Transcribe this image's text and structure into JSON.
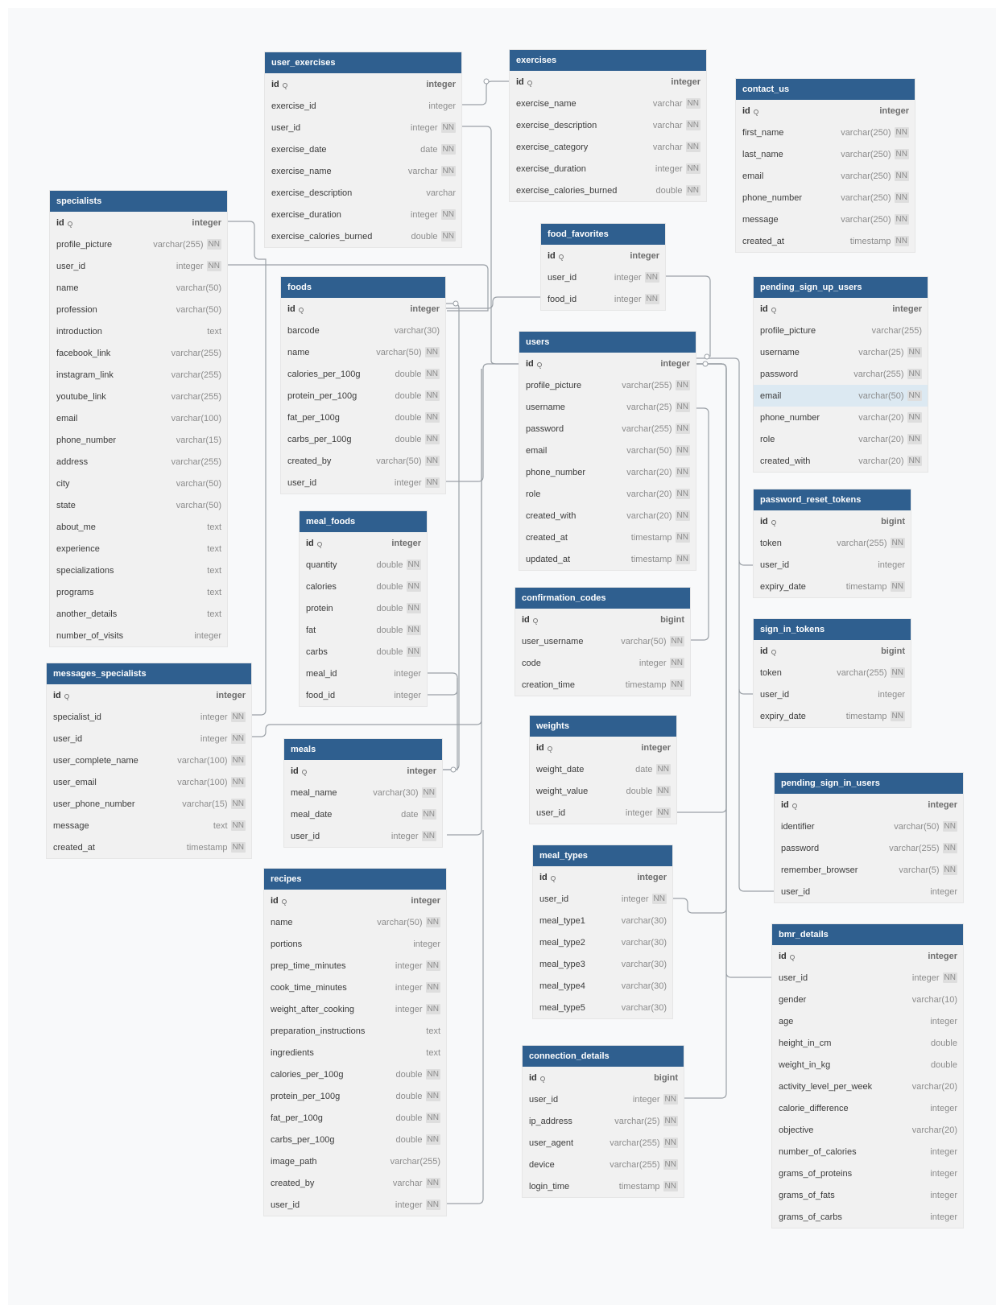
{
  "tables": [
    {
      "name": "user_exercises",
      "fields": [
        {
          "name": "id",
          "type": "integer",
          "pk": true
        },
        {
          "name": "exercise_id",
          "type": "integer"
        },
        {
          "name": "user_id",
          "type": "integer",
          "nn": "NN"
        },
        {
          "name": "exercise_date",
          "type": "date",
          "nn": "NN"
        },
        {
          "name": "exercise_name",
          "type": "varchar",
          "nn": "NN"
        },
        {
          "name": "exercise_description",
          "type": "varchar"
        },
        {
          "name": "exercise_duration",
          "type": "integer",
          "nn": "NN"
        },
        {
          "name": "exercise_calories_burned",
          "type": "double",
          "nn": "NN"
        }
      ]
    },
    {
      "name": "exercises",
      "fields": [
        {
          "name": "id",
          "type": "integer",
          "pk": true
        },
        {
          "name": "exercise_name",
          "type": "varchar",
          "nn": "NN"
        },
        {
          "name": "exercise_description",
          "type": "varchar",
          "nn": "NN"
        },
        {
          "name": "exercise_category",
          "type": "varchar",
          "nn": "NN"
        },
        {
          "name": "exercise_duration",
          "type": "integer",
          "nn": "NN"
        },
        {
          "name": "exercise_calories_burned",
          "type": "double",
          "nn": "NN"
        }
      ]
    },
    {
      "name": "contact_us",
      "fields": [
        {
          "name": "id",
          "type": "integer",
          "pk": true
        },
        {
          "name": "first_name",
          "type": "varchar(250)",
          "nn": "NN"
        },
        {
          "name": "last_name",
          "type": "varchar(250)",
          "nn": "NN"
        },
        {
          "name": "email",
          "type": "varchar(250)",
          "nn": "NN"
        },
        {
          "name": "phone_number",
          "type": "varchar(250)",
          "nn": "NN"
        },
        {
          "name": "message",
          "type": "varchar(250)",
          "nn": "NN"
        },
        {
          "name": "created_at",
          "type": "timestamp",
          "nn": "NN"
        }
      ]
    },
    {
      "name": "specialists",
      "fields": [
        {
          "name": "id",
          "type": "integer",
          "pk": true
        },
        {
          "name": "profile_picture",
          "type": "varchar(255)",
          "nn": "NN"
        },
        {
          "name": "user_id",
          "type": "integer",
          "nn": "NN"
        },
        {
          "name": "name",
          "type": "varchar(50)"
        },
        {
          "name": "profession",
          "type": "varchar(50)"
        },
        {
          "name": "introduction",
          "type": "text"
        },
        {
          "name": "facebook_link",
          "type": "varchar(255)"
        },
        {
          "name": "instagram_link",
          "type": "varchar(255)"
        },
        {
          "name": "youtube_link",
          "type": "varchar(255)"
        },
        {
          "name": "email",
          "type": "varchar(100)"
        },
        {
          "name": "phone_number",
          "type": "varchar(15)"
        },
        {
          "name": "address",
          "type": "varchar(255)"
        },
        {
          "name": "city",
          "type": "varchar(50)"
        },
        {
          "name": "state",
          "type": "varchar(50)"
        },
        {
          "name": "about_me",
          "type": "text"
        },
        {
          "name": "experience",
          "type": "text"
        },
        {
          "name": "specializations",
          "type": "text"
        },
        {
          "name": "programs",
          "type": "text"
        },
        {
          "name": "another_details",
          "type": "text"
        },
        {
          "name": "number_of_visits",
          "type": "integer"
        }
      ]
    },
    {
      "name": "food_favorites",
      "fields": [
        {
          "name": "id",
          "type": "integer",
          "pk": true
        },
        {
          "name": "user_id",
          "type": "integer",
          "nn": "NN"
        },
        {
          "name": "food_id",
          "type": "integer",
          "nn": "NN"
        }
      ]
    },
    {
      "name": "foods",
      "fields": [
        {
          "name": "id",
          "type": "integer",
          "pk": true
        },
        {
          "name": "barcode",
          "type": "varchar(30)"
        },
        {
          "name": "name",
          "type": "varchar(50)",
          "nn": "NN"
        },
        {
          "name": "calories_per_100g",
          "type": "double",
          "nn": "NN"
        },
        {
          "name": "protein_per_100g",
          "type": "double",
          "nn": "NN"
        },
        {
          "name": "fat_per_100g",
          "type": "double",
          "nn": "NN"
        },
        {
          "name": "carbs_per_100g",
          "type": "double",
          "nn": "NN"
        },
        {
          "name": "created_by",
          "type": "varchar(50)",
          "nn": "NN"
        },
        {
          "name": "user_id",
          "type": "integer",
          "nn": "NN"
        }
      ]
    },
    {
      "name": "pending_sign_up_users",
      "fields": [
        {
          "name": "id",
          "type": "integer",
          "pk": true
        },
        {
          "name": "profile_picture",
          "type": "varchar(255)"
        },
        {
          "name": "username",
          "type": "varchar(25)",
          "nn": "NN"
        },
        {
          "name": "password",
          "type": "varchar(255)",
          "nn": "NN"
        },
        {
          "name": "email",
          "type": "varchar(50)",
          "nn": "NN",
          "hl": true
        },
        {
          "name": "phone_number",
          "type": "varchar(20)",
          "nn": "NN"
        },
        {
          "name": "role",
          "type": "varchar(20)",
          "nn": "NN"
        },
        {
          "name": "created_with",
          "type": "varchar(20)",
          "nn": "NN"
        }
      ]
    },
    {
      "name": "users",
      "fields": [
        {
          "name": "id",
          "type": "integer",
          "pk": true
        },
        {
          "name": "profile_picture",
          "type": "varchar(255)",
          "nn": "NN"
        },
        {
          "name": "username",
          "type": "varchar(25)",
          "nn": "NN"
        },
        {
          "name": "password",
          "type": "varchar(255)",
          "nn": "NN"
        },
        {
          "name": "email",
          "type": "varchar(50)",
          "nn": "NN"
        },
        {
          "name": "phone_number",
          "type": "varchar(20)",
          "nn": "NN"
        },
        {
          "name": "role",
          "type": "varchar(20)",
          "nn": "NN"
        },
        {
          "name": "created_with",
          "type": "varchar(20)",
          "nn": "NN"
        },
        {
          "name": "created_at",
          "type": "timestamp",
          "nn": "NN"
        },
        {
          "name": "updated_at",
          "type": "timestamp",
          "nn": "NN"
        }
      ]
    },
    {
      "name": "password_reset_tokens",
      "fields": [
        {
          "name": "id",
          "type": "bigint",
          "pk": true
        },
        {
          "name": "token",
          "type": "varchar(255)",
          "nn": "NN"
        },
        {
          "name": "user_id",
          "type": "integer"
        },
        {
          "name": "expiry_date",
          "type": "timestamp",
          "nn": "NN"
        }
      ]
    },
    {
      "name": "meal_foods",
      "fields": [
        {
          "name": "id",
          "type": "integer",
          "pk": true
        },
        {
          "name": "quantity",
          "type": "double",
          "nn": "NN"
        },
        {
          "name": "calories",
          "type": "double",
          "nn": "NN"
        },
        {
          "name": "protein",
          "type": "double",
          "nn": "NN"
        },
        {
          "name": "fat",
          "type": "double",
          "nn": "NN"
        },
        {
          "name": "carbs",
          "type": "double",
          "nn": "NN"
        },
        {
          "name": "meal_id",
          "type": "integer"
        },
        {
          "name": "food_id",
          "type": "integer"
        }
      ]
    },
    {
      "name": "confirmation_codes",
      "fields": [
        {
          "name": "id",
          "type": "bigint",
          "pk": true
        },
        {
          "name": "user_username",
          "type": "varchar(50)",
          "nn": "NN"
        },
        {
          "name": "code",
          "type": "integer",
          "nn": "NN"
        },
        {
          "name": "creation_time",
          "type": "timestamp",
          "nn": "NN"
        }
      ]
    },
    {
      "name": "sign_in_tokens",
      "fields": [
        {
          "name": "id",
          "type": "bigint",
          "pk": true
        },
        {
          "name": "token",
          "type": "varchar(255)",
          "nn": "NN"
        },
        {
          "name": "user_id",
          "type": "integer"
        },
        {
          "name": "expiry_date",
          "type": "timestamp",
          "nn": "NN"
        }
      ]
    },
    {
      "name": "messages_specialists",
      "fields": [
        {
          "name": "id",
          "type": "integer",
          "pk": true
        },
        {
          "name": "specialist_id",
          "type": "integer",
          "nn": "NN"
        },
        {
          "name": "user_id",
          "type": "integer",
          "nn": "NN"
        },
        {
          "name": "user_complete_name",
          "type": "varchar(100)",
          "nn": "NN"
        },
        {
          "name": "user_email",
          "type": "varchar(100)",
          "nn": "NN"
        },
        {
          "name": "user_phone_number",
          "type": "varchar(15)",
          "nn": "NN"
        },
        {
          "name": "message",
          "type": "text",
          "nn": "NN"
        },
        {
          "name": "created_at",
          "type": "timestamp",
          "nn": "NN"
        }
      ]
    },
    {
      "name": "weights",
      "fields": [
        {
          "name": "id",
          "type": "integer",
          "pk": true
        },
        {
          "name": "weight_date",
          "type": "date",
          "nn": "NN"
        },
        {
          "name": "weight_value",
          "type": "double",
          "nn": "NN"
        },
        {
          "name": "user_id",
          "type": "integer",
          "nn": "NN"
        }
      ]
    },
    {
      "name": "meals",
      "fields": [
        {
          "name": "id",
          "type": "integer",
          "pk": true
        },
        {
          "name": "meal_name",
          "type": "varchar(30)",
          "nn": "NN"
        },
        {
          "name": "meal_date",
          "type": "date",
          "nn": "NN"
        },
        {
          "name": "user_id",
          "type": "integer",
          "nn": "NN"
        }
      ]
    },
    {
      "name": "pending_sign_in_users",
      "fields": [
        {
          "name": "id",
          "type": "integer",
          "pk": true
        },
        {
          "name": "identifier",
          "type": "varchar(50)",
          "nn": "NN"
        },
        {
          "name": "password",
          "type": "varchar(255)",
          "nn": "NN"
        },
        {
          "name": "remember_browser",
          "type": "varchar(5)",
          "nn": "NN"
        },
        {
          "name": "user_id",
          "type": "integer"
        }
      ]
    },
    {
      "name": "meal_types",
      "fields": [
        {
          "name": "id",
          "type": "integer",
          "pk": true
        },
        {
          "name": "user_id",
          "type": "integer",
          "nn": "NN"
        },
        {
          "name": "meal_type1",
          "type": "varchar(30)"
        },
        {
          "name": "meal_type2",
          "type": "varchar(30)"
        },
        {
          "name": "meal_type3",
          "type": "varchar(30)"
        },
        {
          "name": "meal_type4",
          "type": "varchar(30)"
        },
        {
          "name": "meal_type5",
          "type": "varchar(30)"
        }
      ]
    },
    {
      "name": "recipes",
      "fields": [
        {
          "name": "id",
          "type": "integer",
          "pk": true
        },
        {
          "name": "name",
          "type": "varchar(50)",
          "nn": "NN"
        },
        {
          "name": "portions",
          "type": "integer"
        },
        {
          "name": "prep_time_minutes",
          "type": "integer",
          "nn": "NN"
        },
        {
          "name": "cook_time_minutes",
          "type": "integer",
          "nn": "NN"
        },
        {
          "name": "weight_after_cooking",
          "type": "integer",
          "nn": "NN"
        },
        {
          "name": "preparation_instructions",
          "type": "text"
        },
        {
          "name": "ingredients",
          "type": "text"
        },
        {
          "name": "calories_per_100g",
          "type": "double",
          "nn": "NN"
        },
        {
          "name": "protein_per_100g",
          "type": "double",
          "nn": "NN"
        },
        {
          "name": "fat_per_100g",
          "type": "double",
          "nn": "NN"
        },
        {
          "name": "carbs_per_100g",
          "type": "double",
          "nn": "NN"
        },
        {
          "name": "image_path",
          "type": "varchar(255)"
        },
        {
          "name": "created_by",
          "type": "varchar",
          "nn": "NN"
        },
        {
          "name": "user_id",
          "type": "integer",
          "nn": "NN"
        }
      ]
    },
    {
      "name": "bmr_details",
      "fields": [
        {
          "name": "id",
          "type": "integer",
          "pk": true
        },
        {
          "name": "user_id",
          "type": "integer",
          "nn": "NN"
        },
        {
          "name": "gender",
          "type": "varchar(10)"
        },
        {
          "name": "age",
          "type": "integer"
        },
        {
          "name": "height_in_cm",
          "type": "double"
        },
        {
          "name": "weight_in_kg",
          "type": "double"
        },
        {
          "name": "activity_level_per_week",
          "type": "varchar(20)"
        },
        {
          "name": "calorie_difference",
          "type": "integer"
        },
        {
          "name": "objective",
          "type": "varchar(20)"
        },
        {
          "name": "number_of_calories",
          "type": "integer"
        },
        {
          "name": "grams_of_proteins",
          "type": "integer"
        },
        {
          "name": "grams_of_fats",
          "type": "integer"
        },
        {
          "name": "grams_of_carbs",
          "type": "integer"
        }
      ]
    },
    {
      "name": "connection_details",
      "fields": [
        {
          "name": "id",
          "type": "bigint",
          "pk": true
        },
        {
          "name": "user_id",
          "type": "integer",
          "nn": "NN"
        },
        {
          "name": "ip_address",
          "type": "varchar(25)",
          "nn": "NN"
        },
        {
          "name": "user_agent",
          "type": "varchar(255)",
          "nn": "NN"
        },
        {
          "name": "device",
          "type": "varchar(255)",
          "nn": "NN"
        },
        {
          "name": "login_time",
          "type": "timestamp",
          "nn": "NN"
        }
      ]
    }
  ]
}
